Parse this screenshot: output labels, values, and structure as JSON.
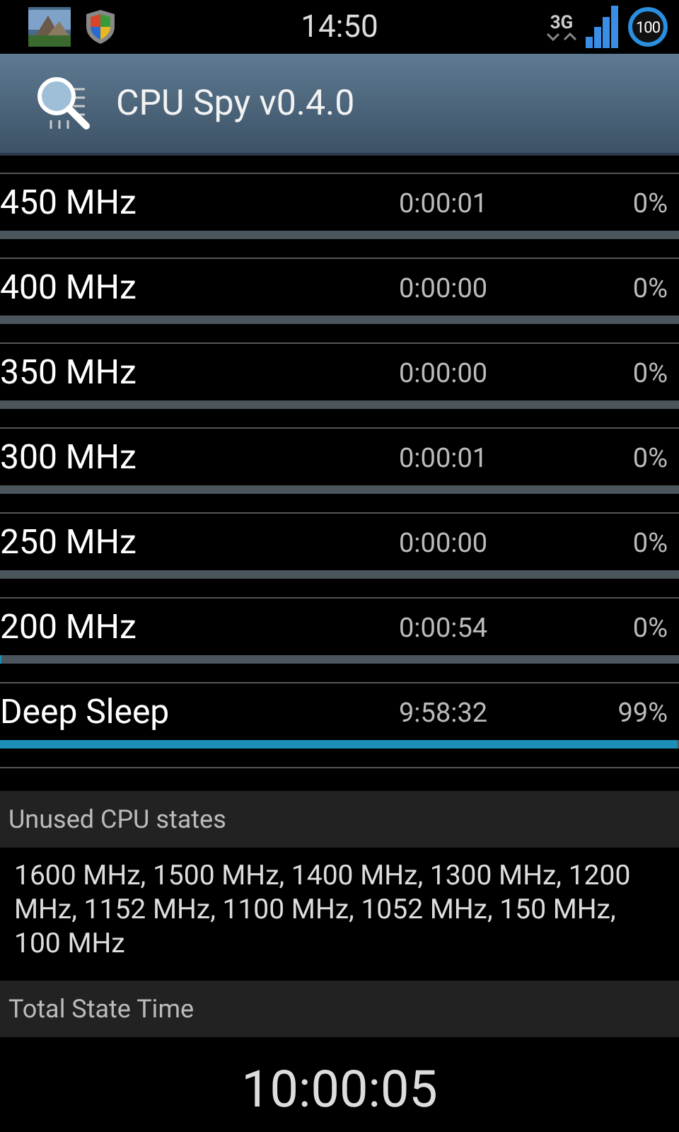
{
  "status_bar": {
    "time": "14:50",
    "network": "3G",
    "battery": "100"
  },
  "action_bar": {
    "title": "CPU Spy v0.4.0"
  },
  "states": [
    {
      "frequency": "450 MHz",
      "time": "0:00:01",
      "percent": "0%"
    },
    {
      "frequency": "400 MHz",
      "time": "0:00:00",
      "percent": "0%"
    },
    {
      "frequency": "350 MHz",
      "time": "0:00:00",
      "percent": "0%"
    },
    {
      "frequency": "300 MHz",
      "time": "0:00:01",
      "percent": "0%"
    },
    {
      "frequency": "250 MHz",
      "time": "0:00:00",
      "percent": "0%"
    },
    {
      "frequency": "200 MHz",
      "time": "0:00:54",
      "percent": "0%",
      "level": 0.0015
    },
    {
      "frequency": "Deep Sleep",
      "time": "9:58:32",
      "percent": "99%",
      "level": 0.997
    }
  ],
  "unused_states": {
    "header": "Unused CPU states",
    "text": "1600 MHz, 1500 MHz, 1400 MHz, 1300 MHz, 1200 MHz, 1152 MHz, 1100 MHz, 1052 MHz, 150 MHz, 100 MHz"
  },
  "total_state_time": {
    "header": "Total State Time",
    "value": "10:00:05"
  }
}
